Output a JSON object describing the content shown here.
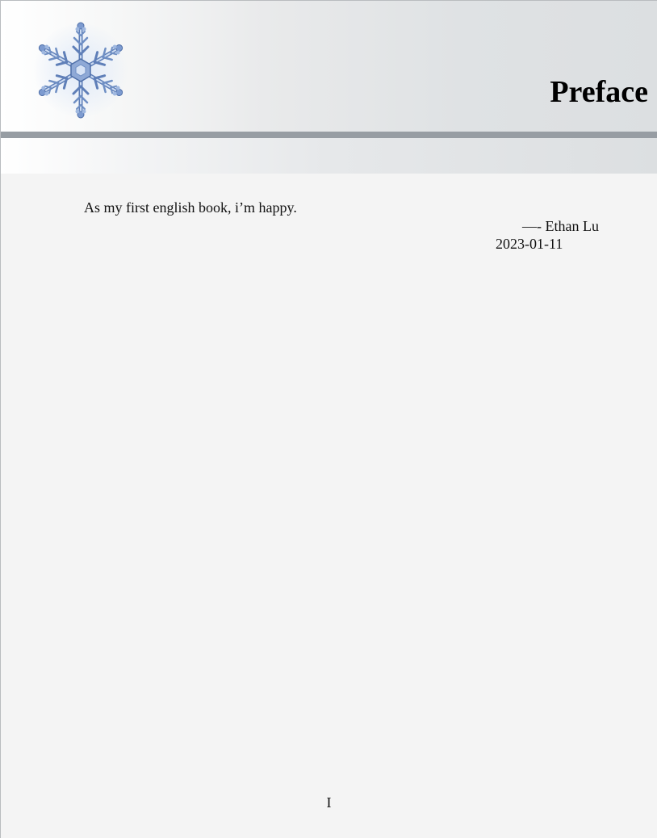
{
  "header": {
    "title": "Preface",
    "decoration_icon": "snowflake-icon",
    "colors": {
      "rule_bar": "#979da3",
      "snowflake_primary": "#6f8fc4",
      "snowflake_light": "#c3d4ee",
      "background": "#f4f4f4"
    }
  },
  "content": {
    "paragraph": "As my first english book, i’m happy.",
    "signature_dash": "—-",
    "signature_name": "Ethan Lu",
    "date": "2023-01-11"
  },
  "footer": {
    "page_number": "I"
  }
}
